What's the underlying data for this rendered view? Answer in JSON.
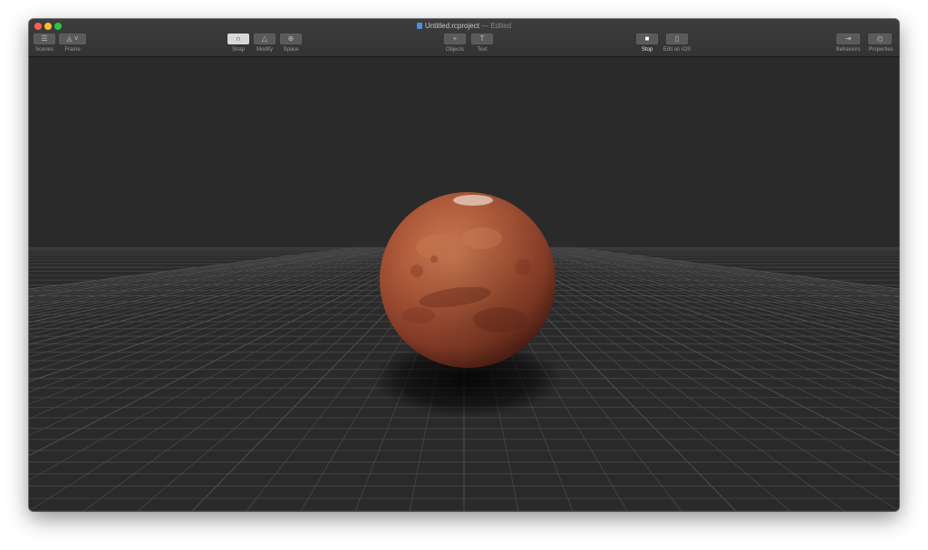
{
  "window": {
    "title": "Untitled.rcproject",
    "edited": "— Edited",
    "controls": {
      "close_color": "#fe5f57",
      "minimize_color": "#febc2e",
      "zoom_color": "#28c840"
    }
  },
  "toolbar": {
    "scenes_label": "Scenes",
    "frame_label": "Frame",
    "snap_label": "Snap",
    "modify_label": "Modify",
    "space_label": "Space",
    "objects_label": "Objects",
    "text_label": "Text",
    "stop_label": "Stop",
    "edit_ios_label": "Edit on iOS",
    "behaviors_label": "Behaviors",
    "properties_label": "Properties"
  },
  "icons": {
    "scenes": "list-icon",
    "frame": "frame-icon",
    "snap": "magnet-icon",
    "modify": "transform-icon",
    "space": "world-space-icon",
    "objects": "plus-icon",
    "text": "text-icon",
    "stop": "stop-icon",
    "edit_ios": "device-icon",
    "behaviors": "behaviors-icon",
    "properties": "properties-icon"
  },
  "scene": {
    "object": "mars-sphere",
    "colors": {
      "planet_main": "#a8553a",
      "planet_dark": "#6e2e1e",
      "planet_light": "#c9784f",
      "background": "#2a2a2a",
      "grid": "#4a4a4a"
    }
  }
}
